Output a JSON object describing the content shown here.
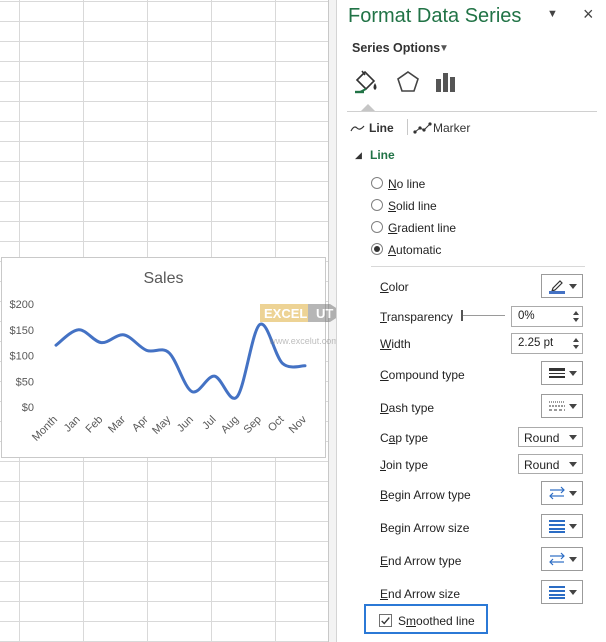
{
  "pane": {
    "title": "Format Data Series",
    "series_options_label": "Series Options",
    "category_icons": [
      "fill-line-icon",
      "effects-pentagon-icon",
      "series-options-bars-icon"
    ]
  },
  "tabs": {
    "line": "Line",
    "marker": "Marker"
  },
  "line_section": {
    "label": "Line",
    "options": [
      {
        "label": "No line",
        "accel": "N",
        "rest": "o line",
        "checked": false
      },
      {
        "label": "Solid line",
        "accel": "S",
        "rest": "olid line",
        "checked": false
      },
      {
        "label": "Gradient line",
        "accel": "G",
        "rest": "radient line",
        "checked": false
      },
      {
        "label": "Automatic",
        "accel": "A",
        "rest": "utomatic",
        "checked": true
      }
    ]
  },
  "properties": {
    "color_label": "Color",
    "color_accent": "#4472C4",
    "transparency_label": "Transparency",
    "transparency_value": "0%",
    "transparency_level": 0,
    "width_label": "Width",
    "width_value": "2.25 pt",
    "compound_label": "Compound type",
    "dash_label": "Dash type",
    "cap_label": "Cap type",
    "cap_value": "Round",
    "join_label": "Join type",
    "join_value": "Round",
    "begin_arrow_type_label": "Begin Arrow type",
    "begin_arrow_size_label": "Begin Arrow size",
    "end_arrow_type_label": "End Arrow type",
    "end_arrow_size_label": "End Arrow size",
    "smoothed_label": "Smoothed line",
    "smoothed_checked": true
  },
  "watermark": {
    "text": "EXCELUT",
    "url": "www.excelut.com"
  },
  "chart_data": {
    "type": "line",
    "title": "Sales",
    "categories": [
      "Month",
      "Jan",
      "Feb",
      "Mar",
      "Apr",
      "May",
      "Jun",
      "Jul",
      "Aug",
      "Sep",
      "Oct",
      "Nov"
    ],
    "series": [
      {
        "values": [
          120,
          150,
          125,
          140,
          110,
          105,
          30,
          60,
          20,
          160,
          85,
          80
        ],
        "color": "#4472C4"
      }
    ],
    "yticks": [
      "$0",
      "$50",
      "$100",
      "$150",
      "$200"
    ],
    "ylim": [
      0,
      200
    ],
    "smoothed": true,
    "gridlines": false,
    "legend": "none"
  }
}
